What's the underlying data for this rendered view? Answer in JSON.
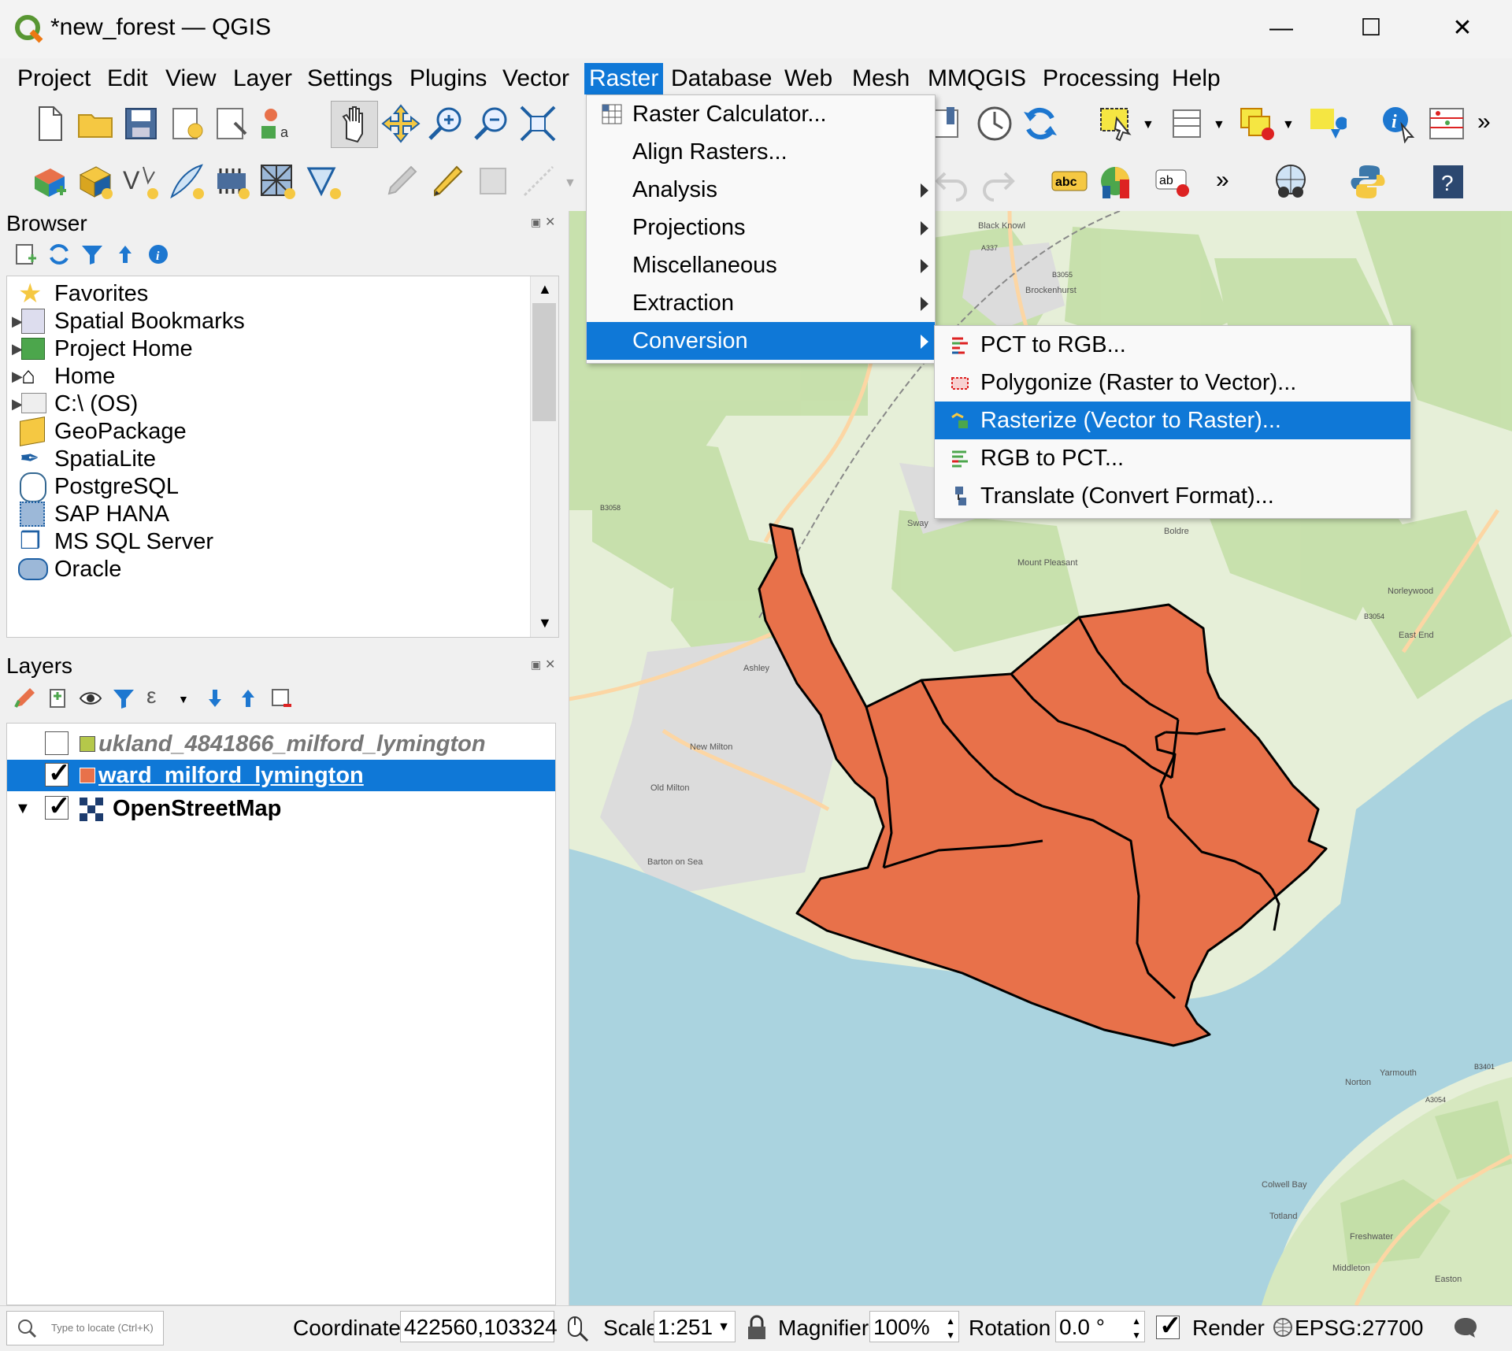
{
  "window": {
    "title": "*new_forest — QGIS"
  },
  "menubar": {
    "items": [
      "Project",
      "Edit",
      "View",
      "Layer",
      "Settings",
      "Plugins",
      "Vector",
      "Raster",
      "Database",
      "Web",
      "Mesh",
      "MMQGIS",
      "Processing",
      "Help"
    ],
    "active": "Raster"
  },
  "raster_menu": {
    "items": [
      "Raster Calculator...",
      "Align Rasters...",
      "Analysis",
      "Projections",
      "Miscellaneous",
      "Extraction",
      "Conversion"
    ],
    "highlighted": "Conversion"
  },
  "conversion_submenu": {
    "items": [
      "PCT to RGB...",
      "Polygonize (Raster to Vector)...",
      "Rasterize (Vector to Raster)...",
      "RGB to PCT...",
      "Translate (Convert Format)..."
    ],
    "highlighted": "Rasterize (Vector to Raster)..."
  },
  "browser": {
    "title": "Browser",
    "items": [
      "Favorites",
      "Spatial Bookmarks",
      "Project Home",
      "Home",
      "C:\\ (OS)",
      "GeoPackage",
      "SpatiaLite",
      "PostgreSQL",
      "SAP HANA",
      "MS SQL Server",
      "Oracle"
    ]
  },
  "layers": {
    "title": "Layers",
    "items": [
      {
        "name": "ukland_4841866_milford_lymington",
        "checked": false
      },
      {
        "name": "ward_milford_lymington",
        "checked": true
      },
      {
        "name": "OpenStreetMap",
        "checked": true
      }
    ]
  },
  "map": {
    "labels": [
      "Black Knowl",
      "Brockenhurst",
      "Ashley",
      "New Milton",
      "Old Milton",
      "Barton on Sea",
      "Mount Pleasant",
      "Boldre",
      "Norleywood",
      "East End",
      "Yarmouth",
      "Norton",
      "Colwell Bay",
      "Totland",
      "Freshwater",
      "Middleton",
      "Easton",
      "Sway",
      "A337",
      "B3055",
      "B3058",
      "B3054",
      "A3054",
      "B3401"
    ],
    "polygon_color": "#e8714a",
    "sea_color": "#aad3df",
    "land_color": "#e6efd8"
  },
  "statusbar": {
    "locate_placeholder": "Type to locate (Ctrl+K)",
    "coordinate_label": "Coordinate",
    "coordinate_value": "422560,103324",
    "scale_label": "Scale",
    "scale_value": "1:251",
    "magnifier_label": "Magnifier",
    "magnifier_value": "100%",
    "rotation_label": "Rotation",
    "rotation_value": "0.0 °",
    "render_label": "Render",
    "crs": "EPSG:27700"
  }
}
